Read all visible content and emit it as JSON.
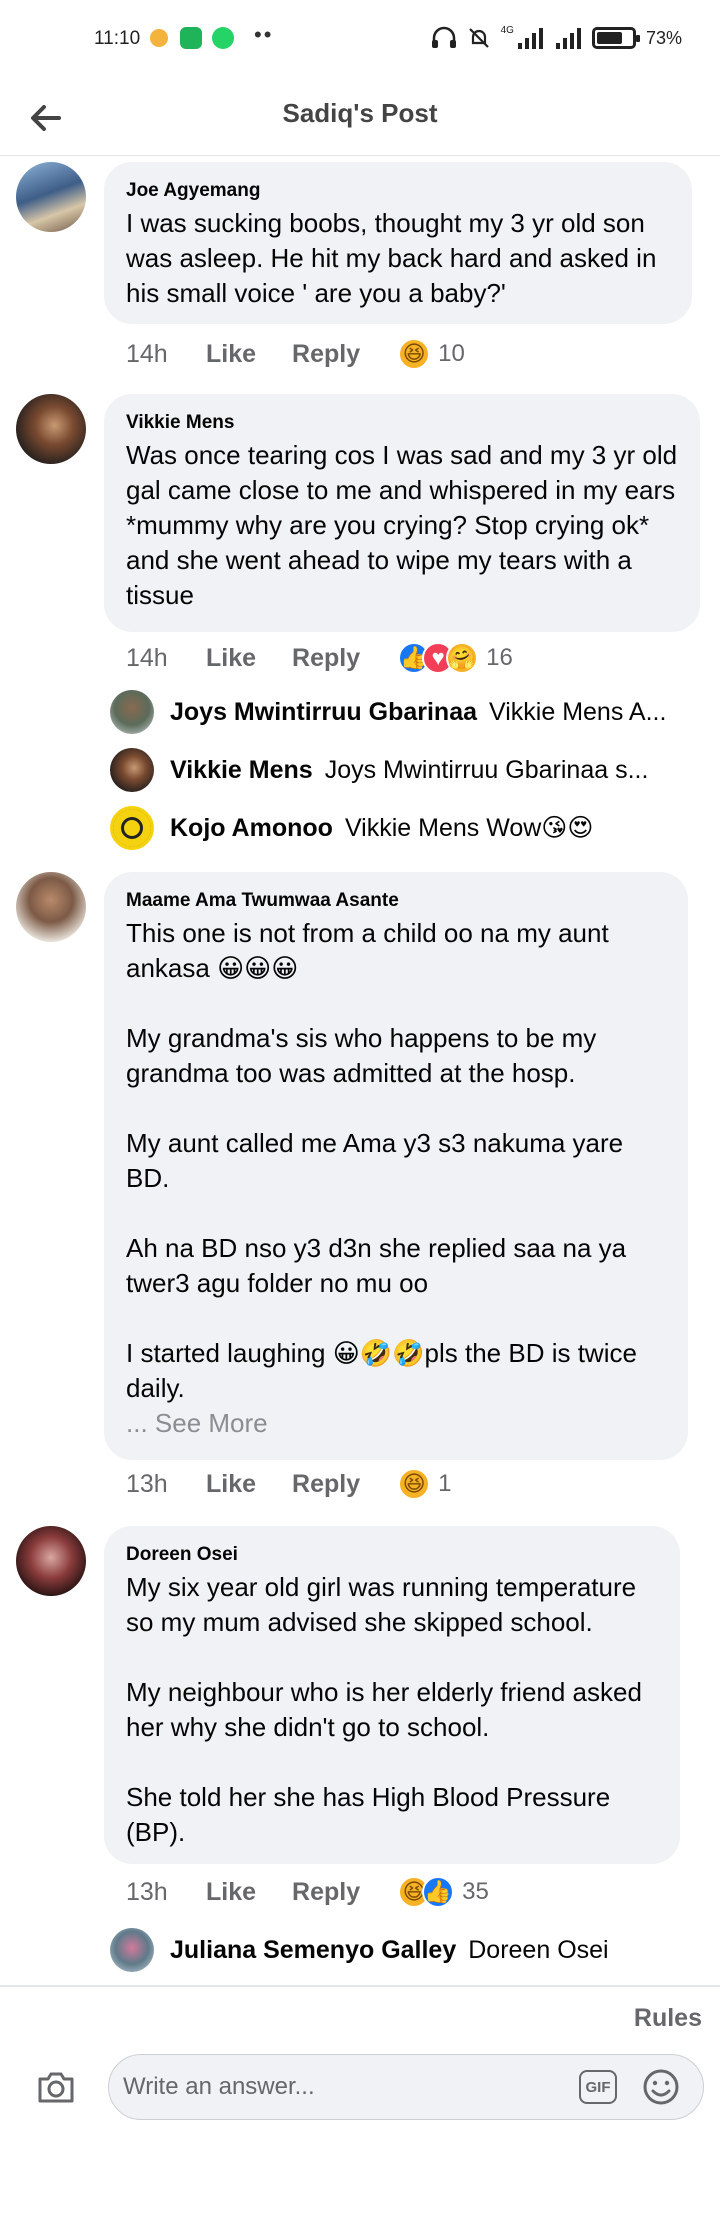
{
  "status_bar": {
    "time": "11:10",
    "battery": "73%",
    "battery_level": 0.73,
    "network": "4G"
  },
  "header": {
    "title": "Sadiq's Post",
    "back_icon": "back-arrow-icon"
  },
  "comments": [
    {
      "author": "Joe Agyemang",
      "text": "I was sucking boobs, thought my 3 yr old son was asleep. He hit my back hard and asked in his small voice ' are you a baby?'",
      "time": "14h",
      "like_label": "Like",
      "reply_label": "Reply",
      "reactions": [
        "haha"
      ],
      "reaction_count": "10"
    },
    {
      "author": "Vikkie Mens",
      "text": "Was once tearing cos I was sad and my 3 yr old gal came close to me and whispered in my ears *mummy why are you crying? Stop crying ok* and she went ahead to wipe my tears with a tissue",
      "time": "14h",
      "like_label": "Like",
      "reply_label": "Reply",
      "reactions": [
        "like",
        "love",
        "care"
      ],
      "reaction_count": "16",
      "replies": [
        {
          "author": "Joys Mwintirruu Gbarinaa",
          "text": "Vikkie Mens A..."
        },
        {
          "author": "Vikkie Mens",
          "text": "Joys Mwintirruu Gbarinaa s..."
        },
        {
          "author": "Kojo Amonoo",
          "text": "Vikkie Mens Wow😘😍"
        }
      ]
    },
    {
      "author": "Maame Ama Twumwaa Asante",
      "text": "This one is not from a child oo na my aunt ankasa 😀😀😀\n\nMy grandma's sis who happens to be my grandma too was admitted at the hosp.\n\nMy aunt called me Ama y3 s3 nakuma yare BD.\n\nAh na BD nso y3 d3n she replied saa na ya twer3 agu folder no mu oo\n\nI started laughing 😀🤣🤣pls the BD is twice daily.",
      "see_more": "... See More",
      "time": "13h",
      "like_label": "Like",
      "reply_label": "Reply",
      "reactions": [
        "haha"
      ],
      "reaction_count": "1"
    },
    {
      "author": "Doreen Osei",
      "text": "My six year old girl was running temperature so my mum advised she skipped school.\n\nMy neighbour who is her elderly friend asked her why she didn't go to school.\n\nShe told her she has High Blood Pressure (BP).",
      "time": "13h",
      "like_label": "Like",
      "reply_label": "Reply",
      "reactions": [
        "haha",
        "like"
      ],
      "reaction_count": "35",
      "replies": [
        {
          "author": "Juliana Semenyo Galley",
          "text": "Doreen Osei"
        }
      ]
    }
  ],
  "footer": {
    "rules_label": "Rules",
    "composer_placeholder": "Write an answer...",
    "gif_label": "GIF",
    "camera_icon": "camera-icon",
    "emoji_icon": "emoji-icon"
  },
  "colors": {
    "bubble": "#f0f2f5",
    "meta_text": "#65676b",
    "like_blue": "#1877f2",
    "haha_yellow": "#f7b125"
  }
}
